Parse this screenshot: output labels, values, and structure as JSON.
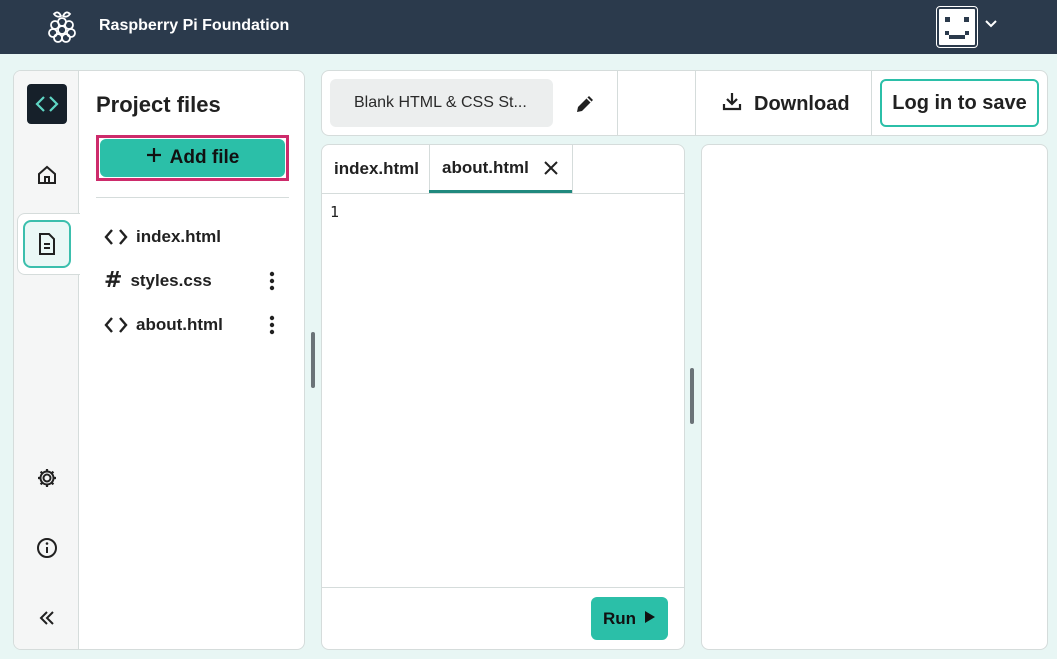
{
  "header": {
    "brand": "Raspberry Pi Foundation",
    "logo_icon": "raspberry-logo-icon",
    "avatar_icon": "smiley-avatar-icon"
  },
  "sidebar": {
    "rail": [
      "code-logo-icon",
      "home-icon",
      "file-icon",
      "gear-icon",
      "info-icon",
      "collapse-icon"
    ],
    "title": "Project files",
    "add_file_label": "Add file",
    "files": [
      {
        "name": "index.html",
        "icon": "code-brackets-icon",
        "menu": false
      },
      {
        "name": "styles.css",
        "icon": "hash-icon",
        "menu": true
      },
      {
        "name": "about.html",
        "icon": "code-brackets-icon",
        "menu": true
      }
    ]
  },
  "toolbar": {
    "project_name": "Blank HTML & CSS St...",
    "download_label": "Download",
    "login_label": "Log in to save"
  },
  "editor": {
    "tabs": [
      {
        "label": "index.html",
        "active": false
      },
      {
        "label": "about.html",
        "active": true
      }
    ],
    "line_numbers": [
      "1"
    ],
    "run_label": "Run"
  },
  "colors": {
    "header_bg": "#2b3a4c",
    "accent": "#2bbfa8",
    "highlight_outline": "#cd2b6b",
    "page_bg": "#e8f6f4"
  }
}
